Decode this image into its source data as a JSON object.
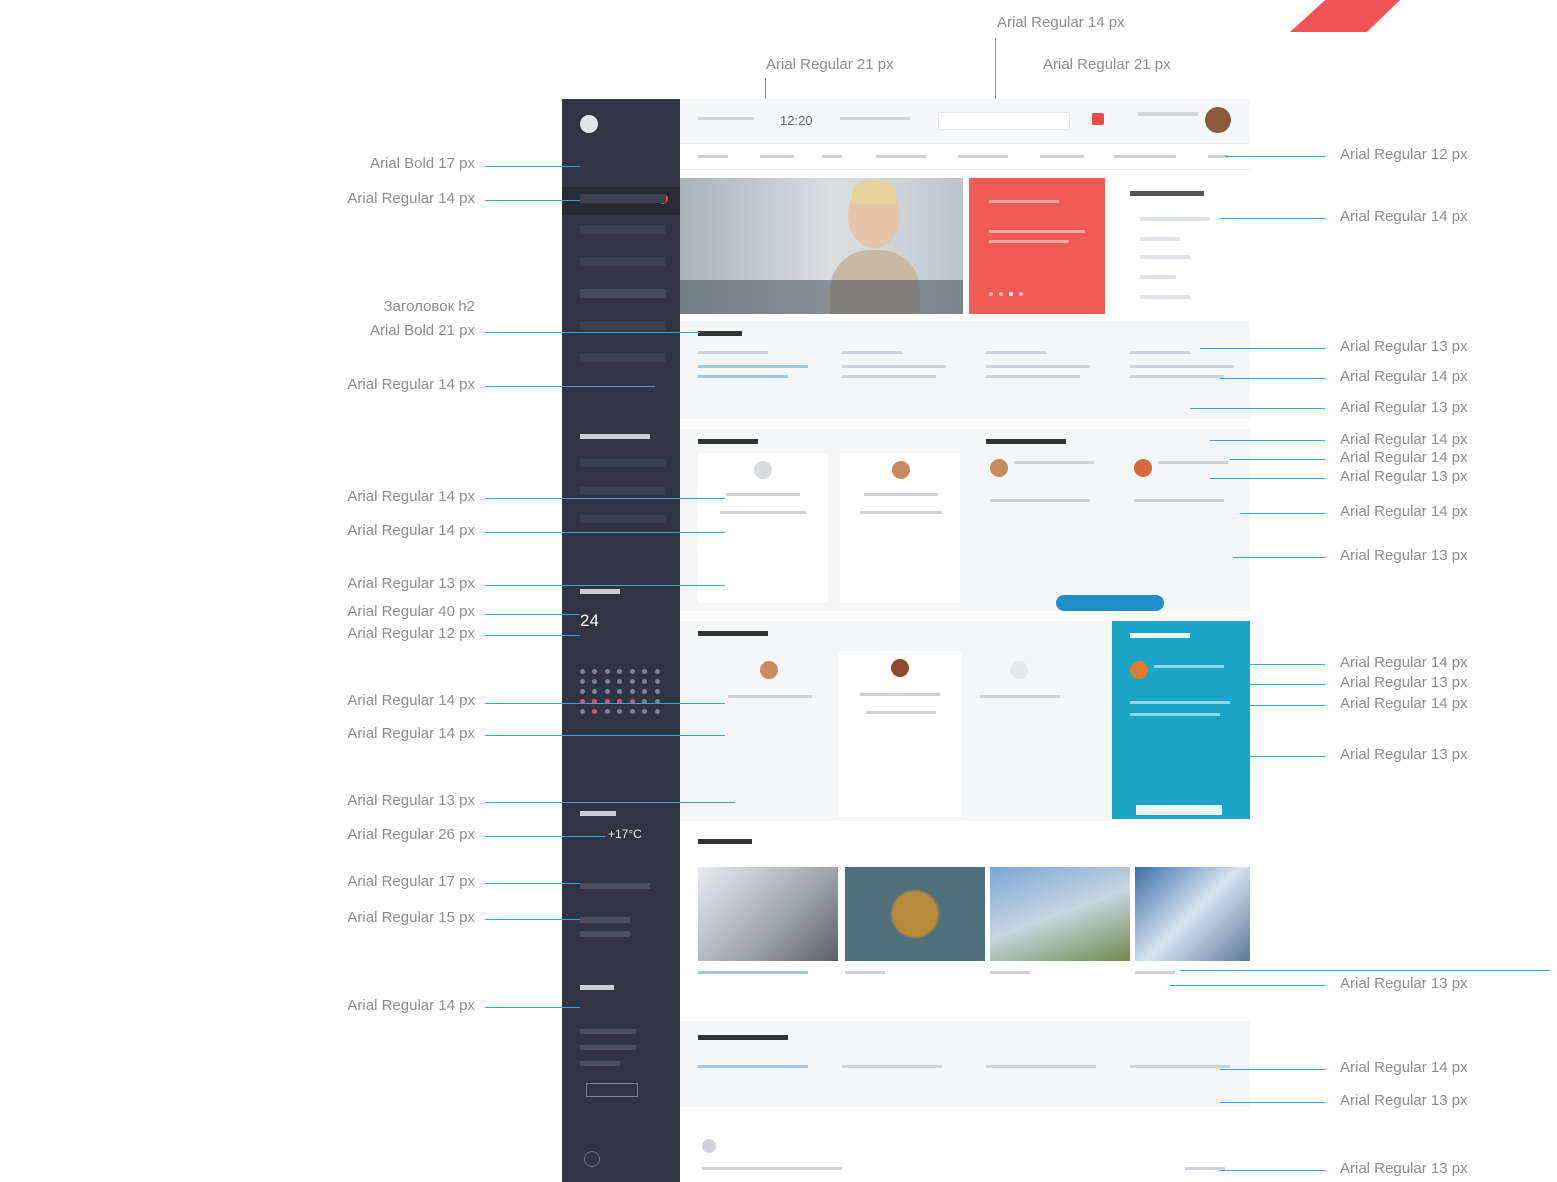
{
  "annotations": {
    "top_center": "Arial Regular 14 px",
    "top_left": "Arial Regular 21 px",
    "top_right": "Arial Regular 21 px",
    "left": [
      "Arial Bold 17 px",
      "Arial Regular 14 px",
      "Заголовок h2",
      "Arial Bold 21 px",
      "Arial Regular 14 px",
      "Arial Regular 14 px",
      "Arial Regular 14 px",
      "Arial Regular 13 px",
      "Arial Regular 40 px",
      "Arial Regular 12 px",
      "Arial Regular 14 px",
      "Arial Regular 14 px",
      "Arial Regular 13 px",
      "Arial Regular 26 px",
      "Arial Regular 17 px",
      "Arial Regular 15 px",
      "Arial Regular 14 px"
    ],
    "right": [
      "Arial Regular 12 px",
      "Arial Regular 14 px",
      "Arial Regular 13 px",
      "Arial Regular 14 px",
      "Arial Regular 13 px",
      "Arial Regular 14 px",
      "Arial Regular 14 px",
      "Arial Regular 13 px",
      "Arial Regular 14 px",
      "Arial Regular 13 px",
      "Arial Regular 14 px",
      "Arial Regular 13 px",
      "Arial Regular 14 px",
      "Arial Regular 13 px",
      "Arial Regular 13 px",
      "Arial Regular 14 px",
      "Arial Regular 13 px",
      "Arial Regular 13 px"
    ]
  },
  "mockup": {
    "time": "12:20",
    "calendar_day": "24",
    "temperature": "+17°C"
  },
  "colors": {
    "accent_line": "#2ea8d8",
    "sidebar": "#2f3542",
    "promo": "#f15b55",
    "cyan_card": "#1aa5c8",
    "corner_shape": "#f05454"
  }
}
